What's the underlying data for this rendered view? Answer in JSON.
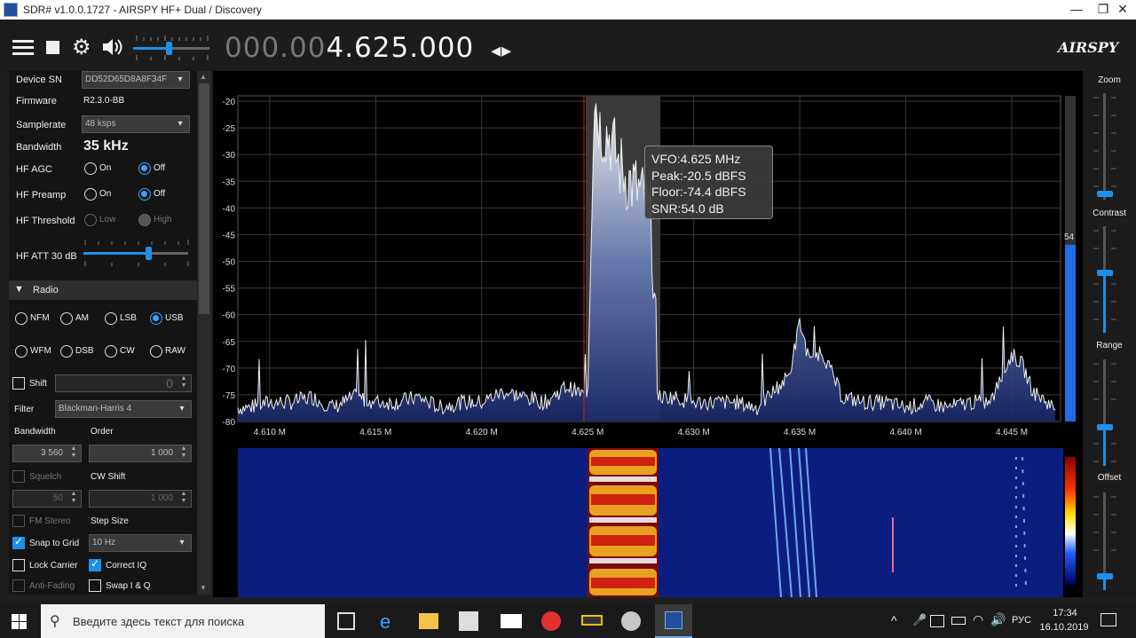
{
  "window": {
    "title": "SDR# v1.0.0.1727 - AIRSPY HF+ Dual / Discovery",
    "min": "—",
    "max": "❐",
    "close": "✕"
  },
  "toolbar": {
    "freq_dim": "000.00",
    "freq_bright": "4.625.000",
    "freq_arrows": "◂▸",
    "brand": "AIRSPY"
  },
  "panel": {
    "device_sn_label": "Device SN",
    "device_sn_value": "DD52D65D8A8F34F",
    "firmware_label": "Firmware",
    "firmware_value": "R2.3.0-BB",
    "samplerate_label": "Samplerate",
    "samplerate_value": "48 ksps",
    "bandwidth_label": "Bandwidth",
    "bandwidth_value": "35 kHz",
    "hf_agc_label": "HF AGC",
    "hf_preamp_label": "HF Preamp",
    "hf_threshold_label": "HF Threshold",
    "on": "On",
    "off": "Off",
    "low": "Low",
    "high": "High",
    "hf_att_label": "HF ATT 30 dB",
    "radio_header": "Radio",
    "modes_row1": [
      "NFM",
      "AM",
      "LSB",
      "USB"
    ],
    "modes_row2": [
      "WFM",
      "DSB",
      "CW",
      "RAW"
    ],
    "shift_label": "Shift",
    "shift_value": "0",
    "filter_label": "Filter",
    "filter_value": "Blackman-Harris 4",
    "bw_label": "Bandwidth",
    "order_label": "Order",
    "bw_value": "3 560",
    "order_value": "1 000",
    "squelch_label": "Squelch",
    "cw_shift_label": "CW Shift",
    "squelch_value": "50",
    "cw_shift_value": "1 000",
    "fm_stereo_label": "FM Stereo",
    "step_size_label": "Step Size",
    "snap_label": "Snap to Grid",
    "step_value": "10 Hz",
    "lock_carrier_label": "Lock Carrier",
    "correct_iq_label": "Correct IQ",
    "anti_fading_label": "Anti-Fading",
    "swap_iq_label": "Swap I & Q"
  },
  "tooltip": {
    "vfo": "VFO:4.625 MHz",
    "peak": "Peak:-20.5 dBFS",
    "floor": "Floor:-74.4 dBFS",
    "snr": "SNR:54.0 dB"
  },
  "right": {
    "zoom": "Zoom",
    "contrast": "Contrast",
    "range": "Range",
    "offset": "Offset",
    "level_value": "54"
  },
  "taskbar": {
    "search_placeholder": "Введите здесь текст для поиска",
    "lang": "РУС",
    "time": "17:34",
    "date": "16.10.2019"
  },
  "chart_data": {
    "type": "line",
    "title": "",
    "xlabel": "",
    "ylabel": "",
    "x_ticks": [
      "4.610 M",
      "4.615 M",
      "4.620 M",
      "4.625 M",
      "4.630 M",
      "4.635 M",
      "4.640 M",
      "4.645 M"
    ],
    "y_ticks": [
      "-20",
      "-25",
      "-30",
      "-35",
      "-40",
      "-45",
      "-50",
      "-55",
      "-60",
      "-65",
      "-70",
      "-75",
      "-80"
    ],
    "xlim": [
      4.6085,
      4.6473
    ],
    "ylim": [
      -80,
      -19
    ],
    "series": [
      {
        "x": [
          4.609,
          4.61,
          4.611,
          4.612,
          4.613,
          4.614,
          4.615,
          4.616,
          4.617,
          4.618,
          4.619,
          4.62,
          4.621,
          4.622,
          4.623,
          4.624,
          4.6245,
          4.625,
          4.6253,
          4.6256,
          4.626,
          4.6265,
          4.627,
          4.6275,
          4.628,
          4.6283,
          4.629,
          4.63,
          4.631,
          4.632,
          4.633,
          4.634,
          4.6345,
          4.635,
          4.6355,
          4.636,
          4.637,
          4.638,
          4.639,
          4.64,
          4.641,
          4.642,
          4.643,
          4.644,
          4.645,
          4.6455,
          4.646,
          4.647
        ],
        "values": [
          -78,
          -77,
          -77,
          -76,
          -78,
          -76,
          -77,
          -77,
          -76,
          -78,
          -77,
          -77,
          -75,
          -76,
          -77,
          -74,
          -75,
          -76,
          -21,
          -28,
          -29,
          -35,
          -38,
          -40,
          -45,
          -76,
          -76,
          -77,
          -77,
          -77,
          -78,
          -74,
          -72,
          -62,
          -70,
          -67,
          -76,
          -77,
          -77,
          -78,
          -77,
          -78,
          -77,
          -77,
          -68,
          -70,
          -75,
          -78
        ]
      }
    ]
  }
}
